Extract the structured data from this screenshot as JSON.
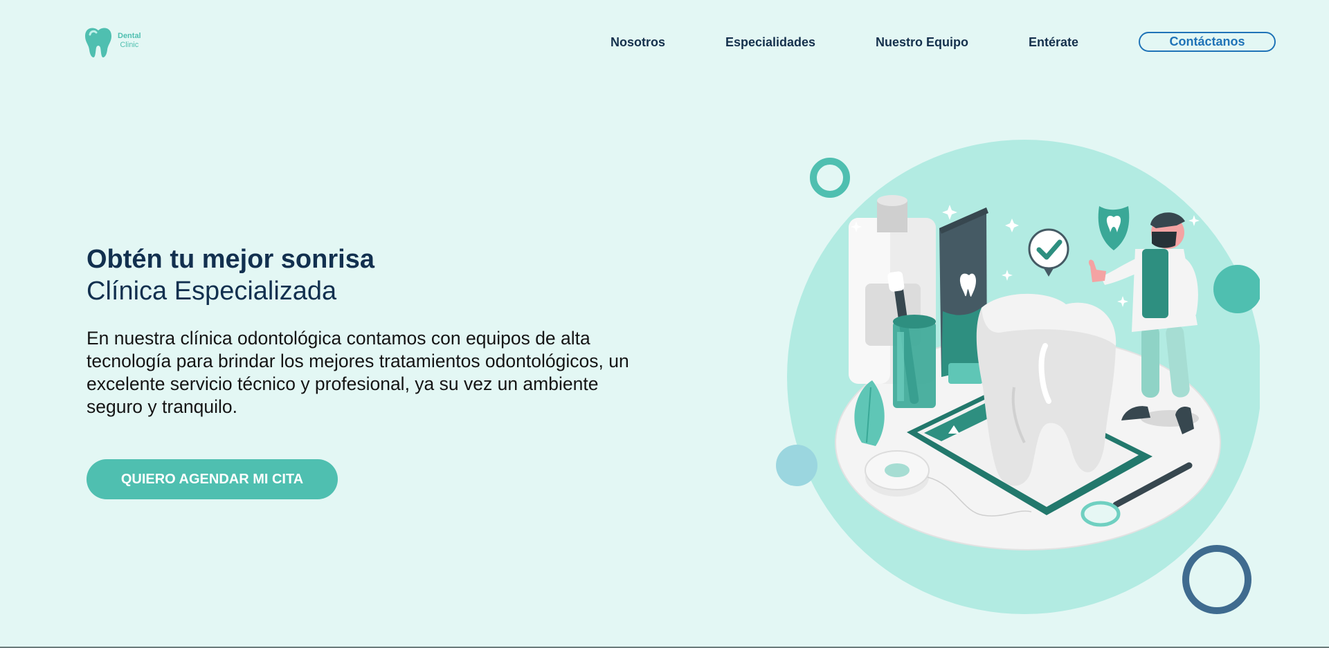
{
  "header": {
    "logo": {
      "line1": "Dental",
      "line2": "Clinic",
      "icon": "tooth-icon"
    },
    "nav": [
      {
        "label": "Nosotros"
      },
      {
        "label": "Especialidades"
      },
      {
        "label": "Nuestro Equipo"
      },
      {
        "label": "Entérate"
      }
    ],
    "contact_label": "Contáctanos"
  },
  "hero": {
    "title": "Obtén tu mejor sonrisa",
    "subtitle": "Clínica Especializada",
    "description": "En nuestra clínica odontológica contamos con equipos de alta tecnología para brindar los mejores tratamientos odontológicos, un excelente servicio técnico y profesional, ya su vez un ambiente seguro y tranquilo.",
    "cta_label": "QUIERO AGENDAR MI CITA"
  },
  "colors": {
    "background": "#e3f7f4",
    "accent": "#4fbfb0",
    "navy": "#12304f",
    "contact_border": "#1f73b7"
  }
}
